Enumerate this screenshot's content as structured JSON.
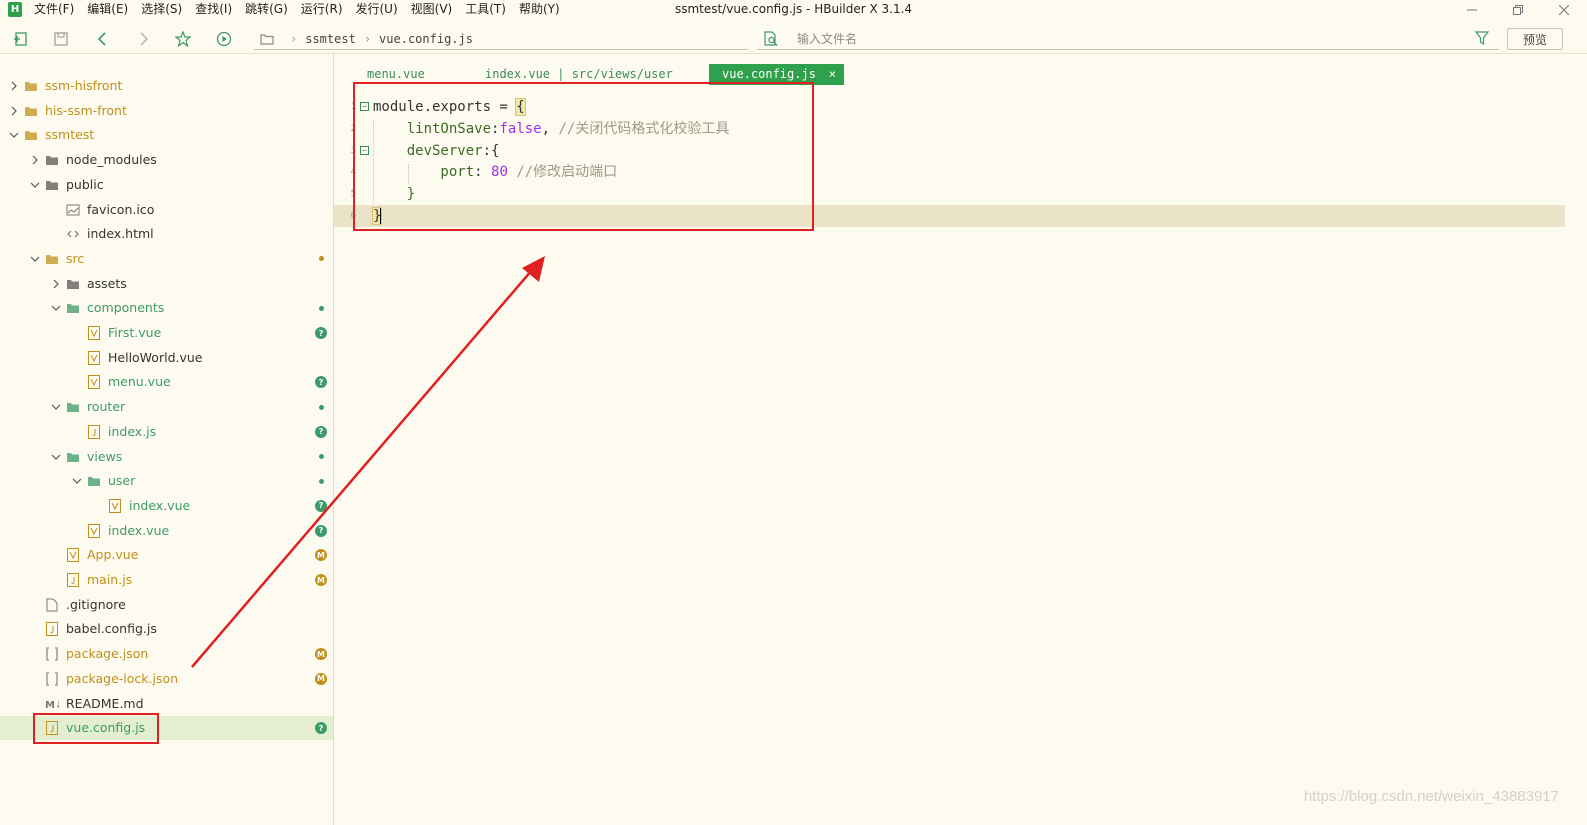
{
  "window": {
    "title": "ssmtest/vue.config.js - HBuilder X 3.1.4",
    "logo": "H",
    "controls": [
      "minimize-icon",
      "restore-icon",
      "close-icon"
    ]
  },
  "menu": [
    "文件(F)",
    "编辑(E)",
    "选择(S)",
    "查找(I)",
    "跳转(G)",
    "运行(R)",
    "发行(U)",
    "视图(V)",
    "工具(T)",
    "帮助(Y)"
  ],
  "toolbar": {
    "icons": [
      "new-file-icon",
      "save-icon",
      "back-icon",
      "forward-icon",
      "favorite-star-icon",
      "run-icon"
    ],
    "breadcrumb": [
      "ssmtest",
      "vue.config.js"
    ],
    "search_placeholder": "输入文件名",
    "preview_label": "预览"
  },
  "tree": [
    {
      "label": "ssm-hisfront",
      "icon": "folder",
      "color": "#c0901c",
      "expanded": false
    },
    {
      "label": "his-ssm-front",
      "icon": "folder",
      "color": "#c0901c",
      "expanded": false
    },
    {
      "label": "ssmtest",
      "icon": "folder",
      "color": "#c0901c",
      "expanded": true
    },
    {
      "label": "node_modules",
      "icon": "folder",
      "color": "#333333",
      "expanded": false
    },
    {
      "label": "public",
      "icon": "folder",
      "color": "#333333",
      "expanded": true
    },
    {
      "label": "favicon.ico",
      "icon": "image",
      "color": "#333333"
    },
    {
      "label": "index.html",
      "icon": "html",
      "color": "#333333"
    },
    {
      "label": "src",
      "icon": "folder",
      "color": "#c0901c",
      "expanded": true,
      "status": "dot",
      "status_color": "#c0901c"
    },
    {
      "label": "assets",
      "icon": "folder",
      "color": "#333333",
      "expanded": false
    },
    {
      "label": "components",
      "icon": "folder",
      "color": "#3d9a6a",
      "expanded": true,
      "status": "dot",
      "status_color": "#3d9a6a"
    },
    {
      "label": "First.vue",
      "icon": "vue",
      "color": "#3d9a6a",
      "status": "?",
      "status_color": "#3d9a6a"
    },
    {
      "label": "HelloWorld.vue",
      "icon": "vue",
      "color": "#333333"
    },
    {
      "label": "menu.vue",
      "icon": "vue",
      "color": "#3d9a6a",
      "status": "?",
      "status_color": "#3d9a6a"
    },
    {
      "label": "router",
      "icon": "folder",
      "color": "#3d9a6a",
      "expanded": true,
      "status": "dot",
      "status_color": "#3d9a6a"
    },
    {
      "label": "index.js",
      "icon": "js",
      "color": "#3d9a6a",
      "status": "?",
      "status_color": "#3d9a6a"
    },
    {
      "label": "views",
      "icon": "folder",
      "color": "#3d9a6a",
      "expanded": true,
      "status": "dot",
      "status_color": "#3d9a6a"
    },
    {
      "label": "user",
      "icon": "folder",
      "color": "#3d9a6a",
      "expanded": true,
      "status": "dot",
      "status_color": "#3d9a6a"
    },
    {
      "label": "index.vue",
      "icon": "vue",
      "color": "#3d9a6a",
      "status": "?",
      "status_color": "#3d9a6a"
    },
    {
      "label": "index.vue",
      "icon": "vue",
      "color": "#3d9a6a",
      "status": "?",
      "status_color": "#3d9a6a"
    },
    {
      "label": "App.vue",
      "icon": "vue",
      "color": "#c0901c",
      "status": "M",
      "status_color": "#c0901c"
    },
    {
      "label": "main.js",
      "icon": "js",
      "color": "#c0901c",
      "status": "M",
      "status_color": "#c0901c"
    },
    {
      "label": ".gitignore",
      "icon": "file",
      "color": "#333333"
    },
    {
      "label": "babel.config.js",
      "icon": "js",
      "color": "#333333"
    },
    {
      "label": "package.json",
      "icon": "json",
      "color": "#c0901c",
      "status": "M",
      "status_color": "#c0901c"
    },
    {
      "label": "package-lock.json",
      "icon": "json",
      "color": "#c0901c",
      "status": "M",
      "status_color": "#c0901c"
    },
    {
      "label": "README.md",
      "icon": "md",
      "color": "#333333"
    },
    {
      "label": "vue.config.js",
      "icon": "js",
      "color": "#3d9a6a",
      "status": "?",
      "status_color": "#3d9a6a",
      "selected": true
    }
  ],
  "tabs": [
    {
      "label": "menu.vue",
      "active": false
    },
    {
      "label": "index.vue | src/views/user",
      "active": false
    },
    {
      "label": "vue.config.js",
      "active": true,
      "close": "×"
    }
  ],
  "code": {
    "line_numbers": [
      "1",
      "2",
      "3",
      "4",
      "5",
      "6"
    ],
    "lines": [
      {
        "tokens": [
          {
            "t": "module.exports = ",
            "c": "id"
          },
          {
            "t": "{",
            "c": "brace-hl"
          }
        ]
      },
      {
        "tokens": [
          {
            "t": "    lintOnSave",
            "c": "pr"
          },
          {
            "t": ":",
            "c": "id"
          },
          {
            "t": "false",
            "c": "kw"
          },
          {
            "t": ", ",
            "c": "id"
          },
          {
            "t": "//关闭代码格式化校验工具",
            "c": "cm"
          }
        ]
      },
      {
        "tokens": [
          {
            "t": "    devServer",
            "c": "pr"
          },
          {
            "t": ":{",
            "c": "id"
          }
        ]
      },
      {
        "tokens": [
          {
            "t": "        port",
            "c": "pr"
          },
          {
            "t": ": ",
            "c": "id"
          },
          {
            "t": "80",
            "c": "num"
          },
          {
            "t": " ",
            "c": "id"
          },
          {
            "t": "//修改启动端口",
            "c": "cm"
          }
        ]
      },
      {
        "tokens": [
          {
            "t": "    }",
            "c": "pr"
          }
        ]
      },
      {
        "tokens": [
          {
            "t": "}",
            "c": "brace-hl"
          }
        ]
      }
    ],
    "current_line": 6
  },
  "watermark": "https://blog.csdn.net/weixin_43883917",
  "annotation_color": "#e02121"
}
